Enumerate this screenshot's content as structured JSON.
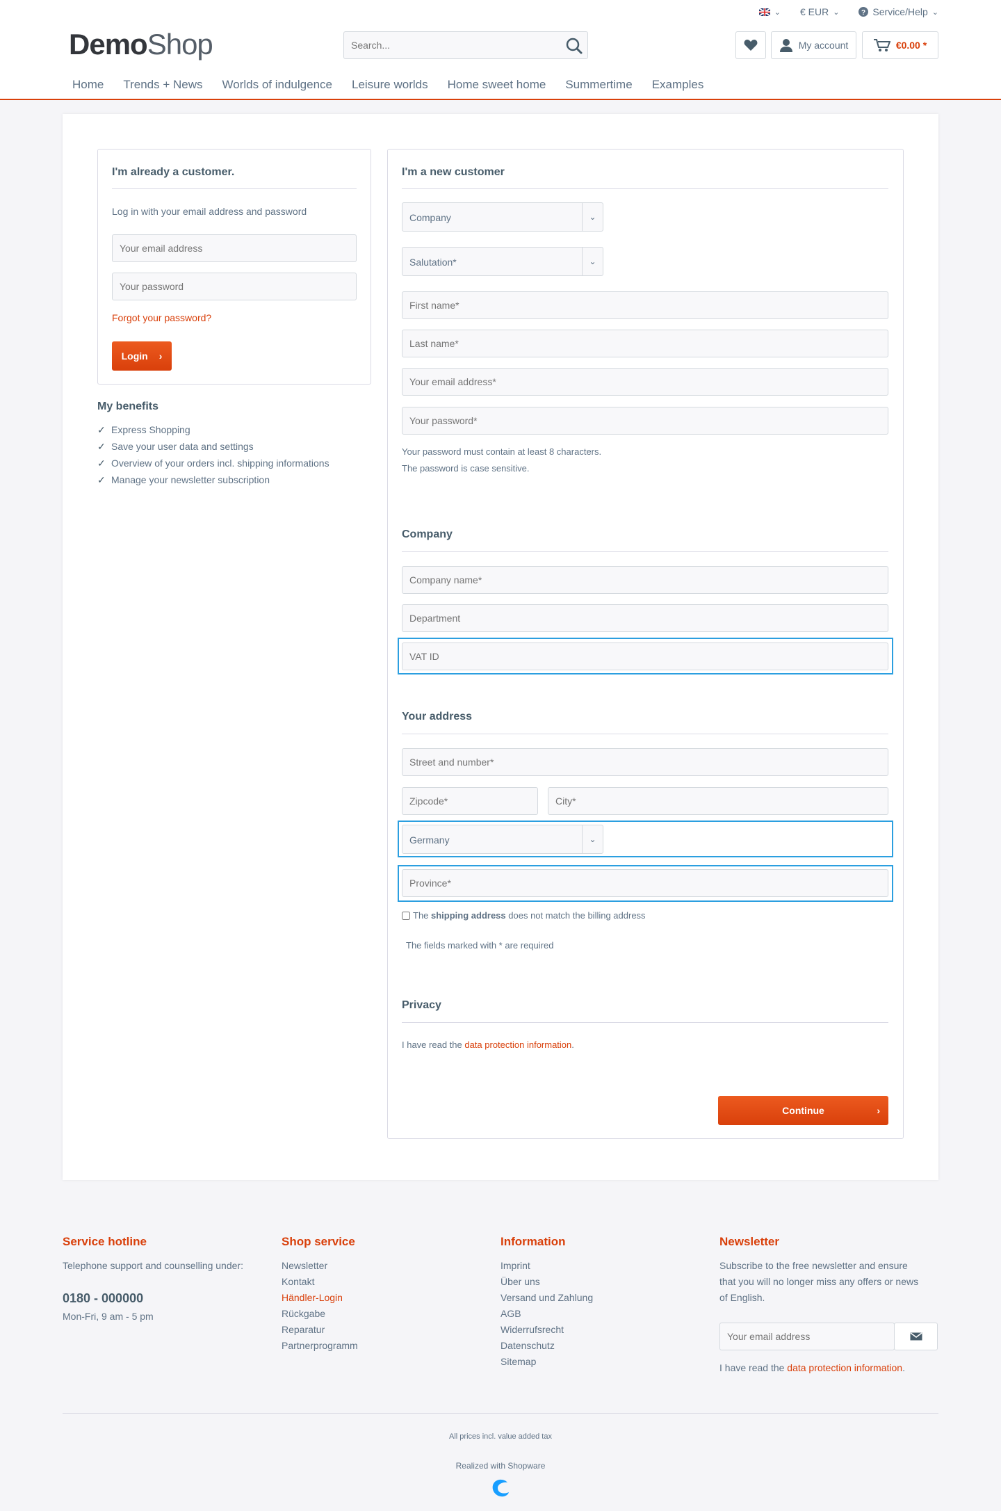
{
  "topbar": {
    "language_icon": "uk-flag-icon",
    "currency": "€ EUR",
    "service": "Service/Help"
  },
  "logo": {
    "bold": "Demo",
    "light": "Shop"
  },
  "search": {
    "placeholder": "Search..."
  },
  "header_actions": {
    "account": "My account",
    "cart_total": "€0.00 *"
  },
  "nav": [
    "Home",
    "Trends + News",
    "Worlds of indulgence",
    "Leisure worlds",
    "Home sweet home",
    "Summertime",
    "Examples"
  ],
  "login": {
    "title": "I'm already a customer.",
    "intro": "Log in with your email address and password",
    "email_placeholder": "Your email address",
    "password_placeholder": "Your password",
    "forgot": "Forgot your password?",
    "button": "Login"
  },
  "benefits": {
    "title": "My benefits",
    "items": [
      "Express Shopping",
      "Save your user data and settings",
      "Overview of your orders incl. shipping informations",
      "Manage your newsletter subscription"
    ]
  },
  "register": {
    "title": "I'm a new customer",
    "customer_type": "Company",
    "salutation": "Salutation*",
    "first_name": "First name*",
    "last_name": "Last name*",
    "email": "Your email address*",
    "password": "Your password*",
    "pw_hint_1": "Your password must contain at least 8 characters.",
    "pw_hint_2": "The password is case sensitive.",
    "company_title": "Company",
    "company_name": "Company name*",
    "department": "Department",
    "vat_id": "VAT ID",
    "address_title": "Your address",
    "street": "Street and number*",
    "zipcode": "Zipcode*",
    "city": "City*",
    "country": "Germany",
    "province": "Province*",
    "shipping_pre": "The ",
    "shipping_bold": "shipping address",
    "shipping_post": " does not match the billing address",
    "required_note": "The fields marked with * are required",
    "privacy_title": "Privacy",
    "privacy_pre": "I have read the ",
    "privacy_link": "data protection information",
    "privacy_post": ".",
    "continue": "Continue"
  },
  "footer": {
    "hotline": {
      "title": "Service hotline",
      "text": "Telephone support and counselling under:",
      "phone": "0180 - 000000",
      "hours": "Mon-Fri, 9 am - 5 pm"
    },
    "shop_service": {
      "title": "Shop service",
      "links": [
        "Newsletter",
        "Kontakt",
        "Händler-Login",
        "Rückgabe",
        "Reparatur",
        "Partnerprogramm"
      ]
    },
    "information": {
      "title": "Information",
      "links": [
        "Imprint",
        "Über uns",
        "Versand und Zahlung",
        "AGB",
        "Widerrufsrecht",
        "Datenschutz",
        "Sitemap"
      ]
    },
    "newsletter": {
      "title": "Newsletter",
      "text_1": "Subscribe to the free newsletter and ensure",
      "text_2": "that you will no longer miss any offers or news",
      "text_3": "of English.",
      "placeholder": "Your email address",
      "privacy_pre": "I have read the ",
      "privacy_link": "data protection information",
      "privacy_post": "."
    },
    "vat_note": "All prices incl. value added tax",
    "realized": "Realized with Shopware"
  },
  "colors": {
    "accent": "#d9400b",
    "highlight": "#2b9fe0",
    "text": "#5f7285"
  }
}
